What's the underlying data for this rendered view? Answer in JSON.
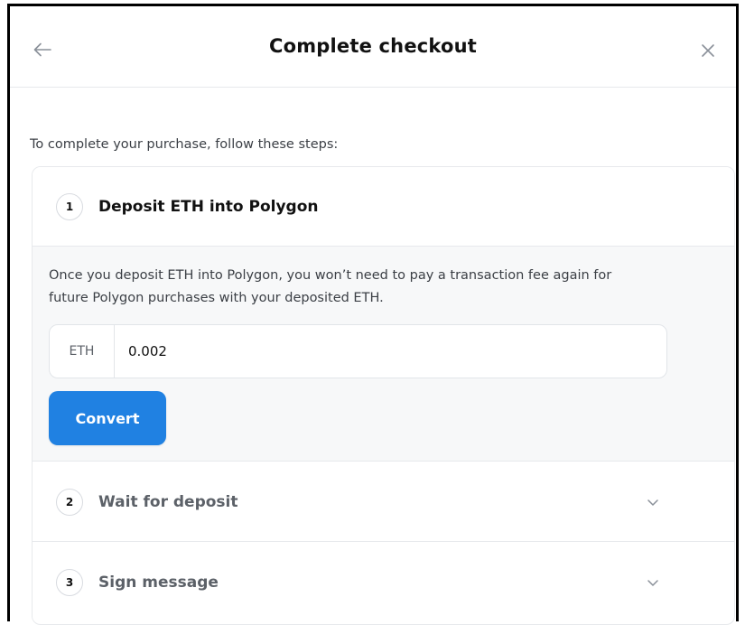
{
  "header": {
    "title": "Complete checkout",
    "back_icon": "arrow-left-icon",
    "close_icon": "close-icon"
  },
  "intro_text": "To complete your purchase, follow these steps:",
  "steps": [
    {
      "number": "1",
      "title": "Deposit ETH into Polygon",
      "expanded": true,
      "description": "Once you deposit ETH into Polygon, you won’t need to pay a transaction fee again for future Polygon purchases with your deposited ETH.",
      "input": {
        "prefix": "ETH",
        "value": "0.002"
      },
      "button_label": "Convert"
    },
    {
      "number": "2",
      "title": "Wait for deposit",
      "expanded": false,
      "icon": "chevron-down-icon"
    },
    {
      "number": "3",
      "title": "Sign message",
      "expanded": false,
      "icon": "chevron-down-icon"
    }
  ],
  "colors": {
    "accent": "#2081e2",
    "border": "#e7e9ec",
    "panel_bg": "#f7f8f9",
    "text_primary": "#111111",
    "text_muted": "#5c6168"
  }
}
